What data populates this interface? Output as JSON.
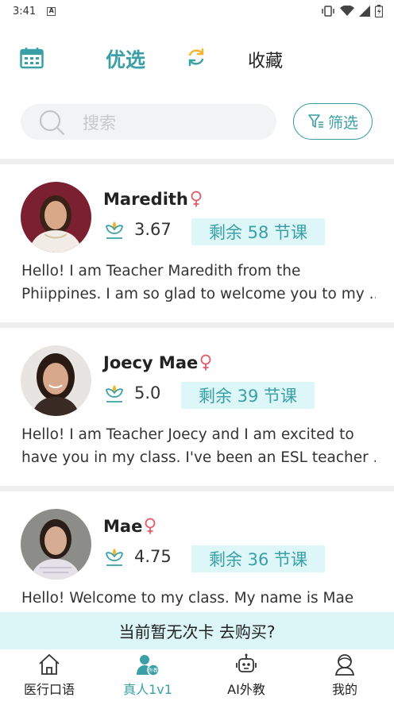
{
  "status_bar": {
    "time": "3:41"
  },
  "header": {
    "tab_active": "优选",
    "tab_other": "收藏"
  },
  "search": {
    "placeholder": "搜索"
  },
  "filter": {
    "label": "筛选"
  },
  "teachers": [
    {
      "name": "Maredith",
      "rating": "3.67",
      "remaining": "剩余 58 节课",
      "desc_line1": "Hello! I am Teacher Maredith from the",
      "desc_line2": "Phiippines. I am so glad to welcome you to my ..."
    },
    {
      "name": "Joecy Mae",
      "rating": "5.0",
      "remaining": "剩余 39 节课",
      "desc_line1": "Hello! I am Teacher Joecy and I am excited to",
      "desc_line2": "have you in my class. I've been an ESL teacher ..."
    },
    {
      "name": "Mae",
      "rating": "4.75",
      "remaining": "剩余 36 节课",
      "desc_line1": "Hello! Welcome to my class. My name is Mae",
      "desc_line2": ""
    }
  ],
  "buy_banner": "当前暂无次卡 去购买?",
  "bottom_nav": [
    {
      "label": "医行口语",
      "icon": "home-icon"
    },
    {
      "label": "真人1v1",
      "icon": "teacher-icon",
      "badge": "外教"
    },
    {
      "label": "AI外教",
      "icon": "robot-icon"
    },
    {
      "label": "我的",
      "icon": "profile-icon"
    }
  ],
  "colors": {
    "accent": "#3aa0a6",
    "badge_bg": "#ddf6f8",
    "female": "#e05a6a"
  }
}
